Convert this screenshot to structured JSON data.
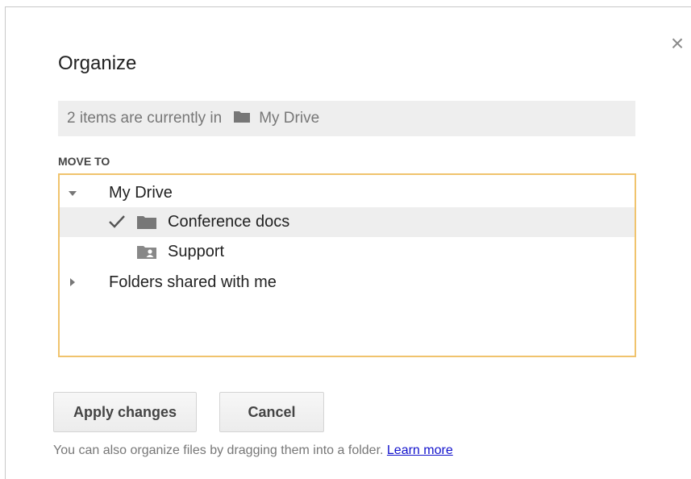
{
  "dialog": {
    "title": "Organize",
    "close_label": "×",
    "current_location": {
      "prefix": "2 items are currently in",
      "folder_icon": "folder-icon",
      "folder_name": "My Drive"
    },
    "move_to_label": "MOVE TO",
    "tree": [
      {
        "label": "My Drive",
        "expander": "expanded",
        "selected": false
      },
      {
        "label": "Conference docs",
        "icon": "folder-icon",
        "checked": true,
        "selected": true
      },
      {
        "label": "Support",
        "icon": "shared-folder-icon",
        "checked": false,
        "selected": false
      },
      {
        "label": "Folders shared with me",
        "expander": "collapsed",
        "selected": false
      }
    ],
    "buttons": {
      "apply": "Apply changes",
      "cancel": "Cancel"
    },
    "footer": {
      "text": "You can also organize files by dragging them into a folder.",
      "link": "Learn more"
    }
  },
  "colors": {
    "tree_border": "#f0c36d",
    "selected_row": "#eeeeee",
    "link": "#1111cc"
  }
}
